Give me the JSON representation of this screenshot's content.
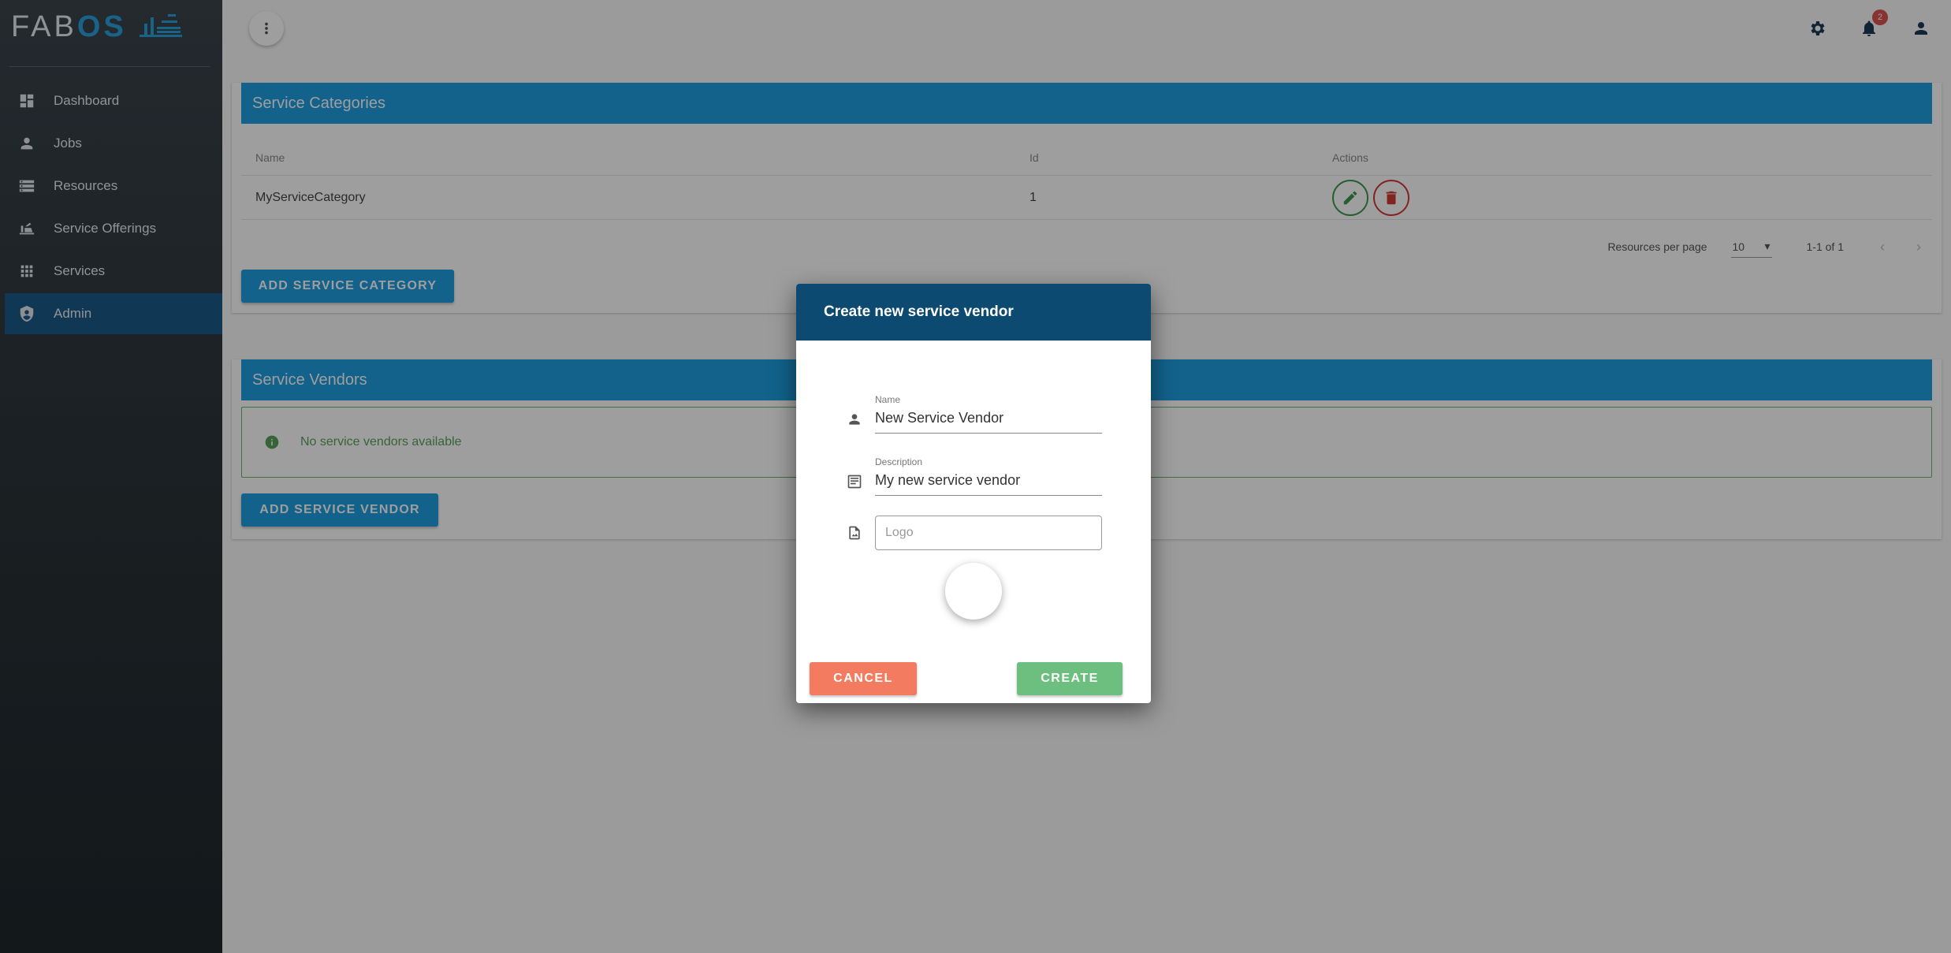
{
  "app": {
    "logo_primary": "FAB",
    "logo_accent": "OS"
  },
  "sidebar": {
    "items": [
      {
        "label": "Dashboard",
        "icon": "dashboard-icon"
      },
      {
        "label": "Jobs",
        "icon": "person-icon"
      },
      {
        "label": "Resources",
        "icon": "storage-icon"
      },
      {
        "label": "Service Offerings",
        "icon": "service-icon"
      },
      {
        "label": "Services",
        "icon": "apps-icon"
      },
      {
        "label": "Admin",
        "icon": "admin-shield-icon",
        "active": true
      }
    ]
  },
  "topbar": {
    "notification_count": "2"
  },
  "service_categories": {
    "title": "Service Categories",
    "columns": [
      "Name",
      "Id",
      "Actions"
    ],
    "rows": [
      {
        "name": "MyServiceCategory",
        "id": "1"
      }
    ],
    "pager": {
      "label": "Resources per page",
      "per_page": "10",
      "range": "1-1 of 1"
    },
    "add_button": "ADD SERVICE CATEGORY"
  },
  "service_vendors": {
    "title": "Service Vendors",
    "empty_message": "No service vendors available",
    "add_button": "ADD SERVICE VENDOR"
  },
  "dialog": {
    "title": "Create new service vendor",
    "name_label": "Name",
    "name_value": "New Service Vendor",
    "description_label": "Description",
    "description_value": "My new service vendor",
    "logo_placeholder": "Logo",
    "cancel_label": "CANCEL",
    "create_label": "CREATE"
  },
  "colors": {
    "accent": "#1e9ee0",
    "dialog_header": "#0d4a72",
    "cancel": "#f37b5f",
    "create": "#6cbf7f",
    "sidebar_active": "#1b5a86"
  }
}
